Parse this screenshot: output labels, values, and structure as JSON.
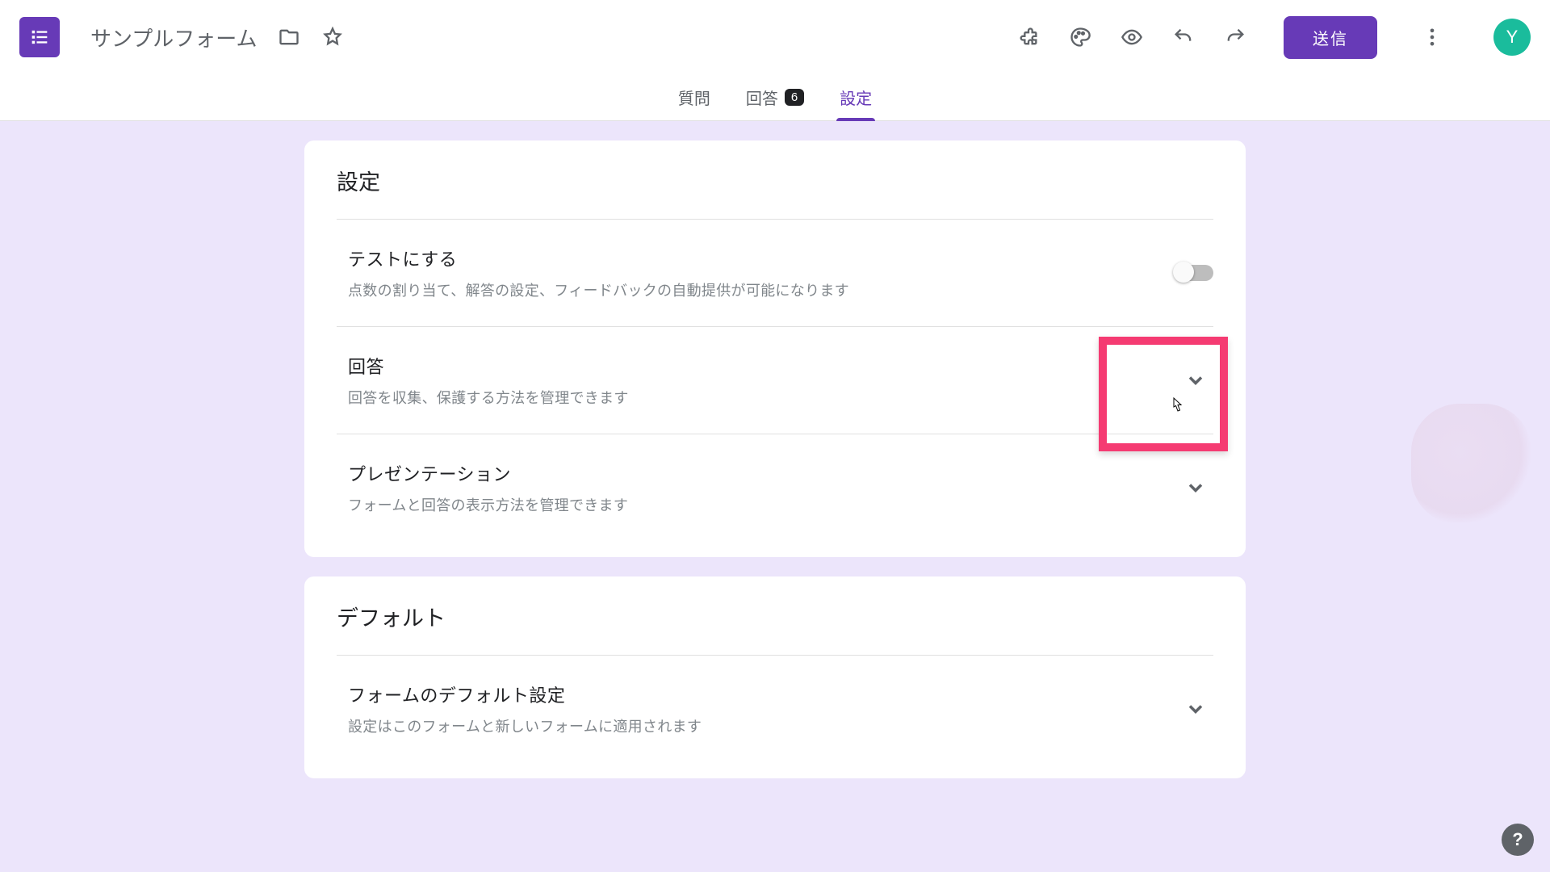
{
  "colors": {
    "brand": "#673ab7",
    "highlight": "#f53b72",
    "avatar_bg": "#1abc9c"
  },
  "header": {
    "form_title": "サンプルフォーム",
    "send_label": "送信",
    "avatar_letter": "Y"
  },
  "tabs": {
    "questions": "質問",
    "responses": "回答",
    "responses_count": "6",
    "settings": "設定",
    "active": "settings"
  },
  "settings_card": {
    "title": "設定",
    "rows": {
      "make_test": {
        "label": "テストにする",
        "desc": "点数の割り当て、解答の設定、フィードバックの自動提供が可能になります",
        "toggle_on": false
      },
      "responses": {
        "label": "回答",
        "desc": "回答を収集、保護する方法を管理できます"
      },
      "presentation": {
        "label": "プレゼンテーション",
        "desc": "フォームと回答の表示方法を管理できます"
      }
    }
  },
  "defaults_card": {
    "title": "デフォルト",
    "rows": {
      "form_defaults": {
        "label": "フォームのデフォルト設定",
        "desc": "設定はこのフォームと新しいフォームに適用されます"
      }
    }
  },
  "help_label": "?"
}
